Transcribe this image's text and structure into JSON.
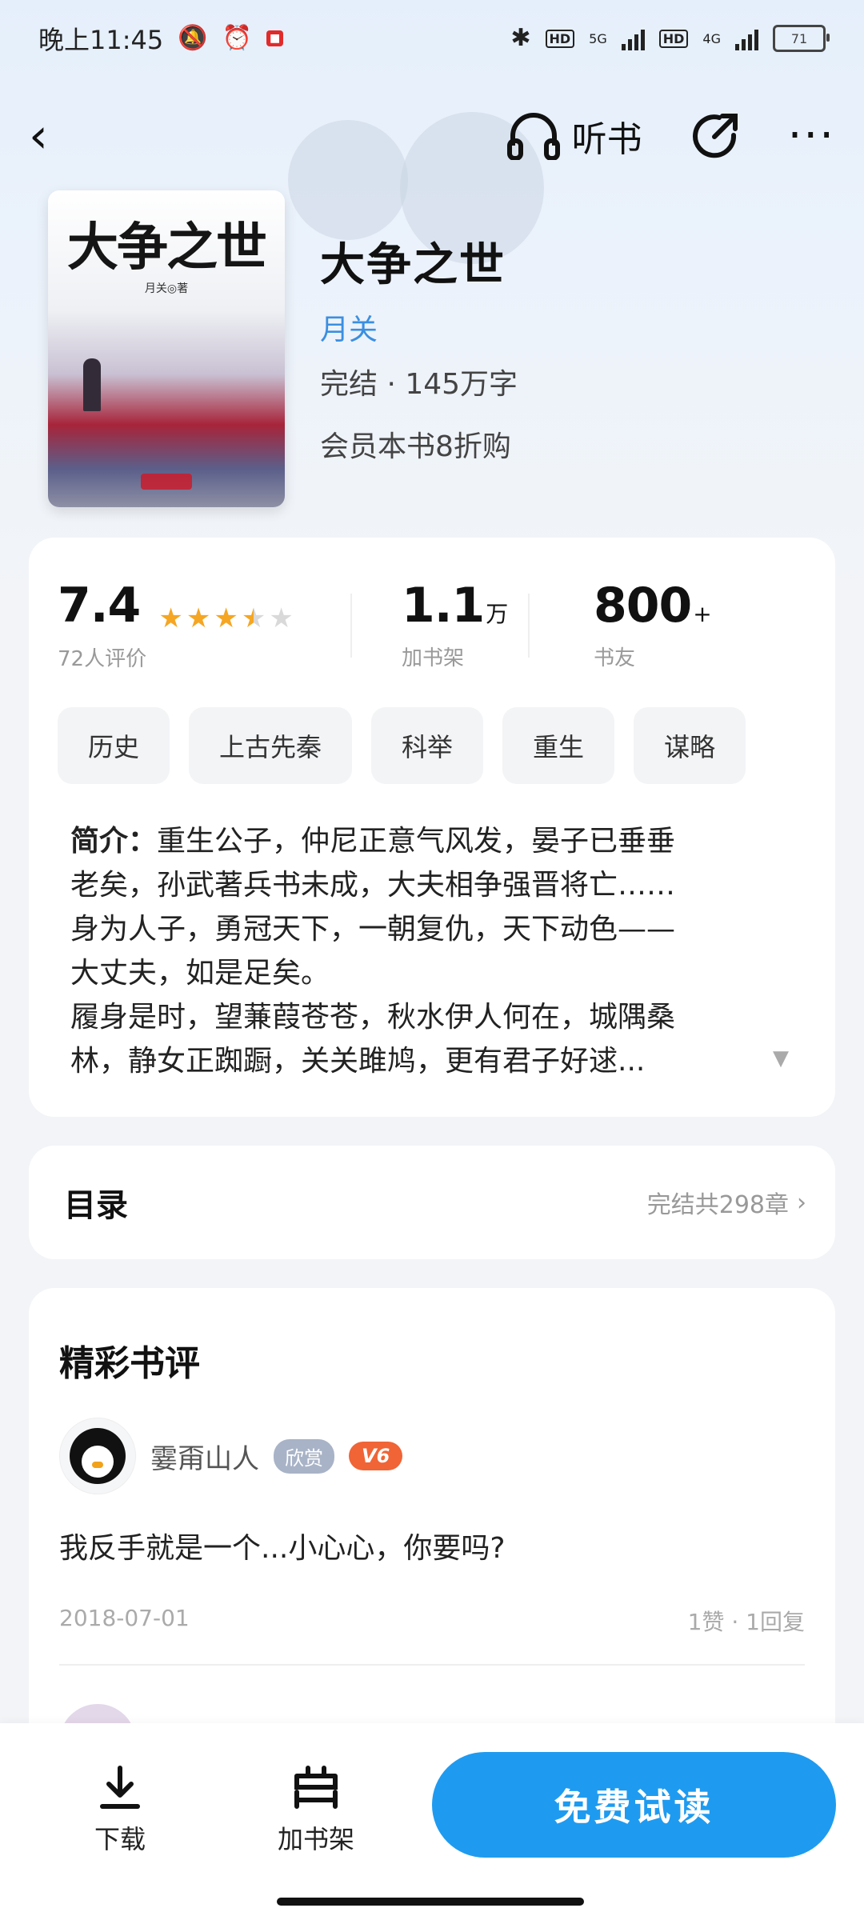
{
  "status": {
    "time": "晚上11:45",
    "battery": "71",
    "net1": "5G",
    "net2": "4G",
    "hd": "HD"
  },
  "nav": {
    "listen_label": "听书"
  },
  "book": {
    "title": "大争之世",
    "author": "月关",
    "meta": "完结 · 145万字",
    "vip_offer": "会员本书8折购",
    "cover_title": "大争之世",
    "cover_author": "月关◎著"
  },
  "stats": {
    "rating": "7.4",
    "rating_stars": 3.5,
    "rating_label": "72人评价",
    "shelf_num": "1.1",
    "shelf_unit": "万",
    "shelf_label": "加书架",
    "fans_num": "800",
    "fans_unit": "+",
    "fans_label": "书友"
  },
  "tags": [
    "历史",
    "上古先秦",
    "科举",
    "重生",
    "谋略"
  ],
  "intro": {
    "label": "简介：",
    "lines": [
      "重生公子，仲尼正意气风发，晏子已垂垂",
      "老矣，孙武著兵书未成，大夫相争强晋将亡……",
      "身为人子，勇冠天下，一朝复仇，天下动色——",
      "大丈夫，如是足矣。",
      "履身是时，望蒹葭苍苍，秋水伊人何在，城隅桑",
      "林，静女正踟蹰，关关雎鸠，更有君子好逑..."
    ]
  },
  "toc": {
    "title": "目录",
    "summary": "完结共298章"
  },
  "reviews": {
    "title": "精彩书评",
    "items": [
      {
        "user": "霎甭山人",
        "badge": "欣赏",
        "level": "V6",
        "text": "我反手就是一个...小心心，你要吗?",
        "date": "2018-07-01",
        "stats": "1赞 · 1回复"
      }
    ]
  },
  "bottom": {
    "download": "下载",
    "add_shelf": "加书架",
    "read": "免费试读"
  },
  "colors": {
    "accent": "#1e9bf0",
    "author": "#3b8fe0",
    "star": "#f5a623"
  }
}
